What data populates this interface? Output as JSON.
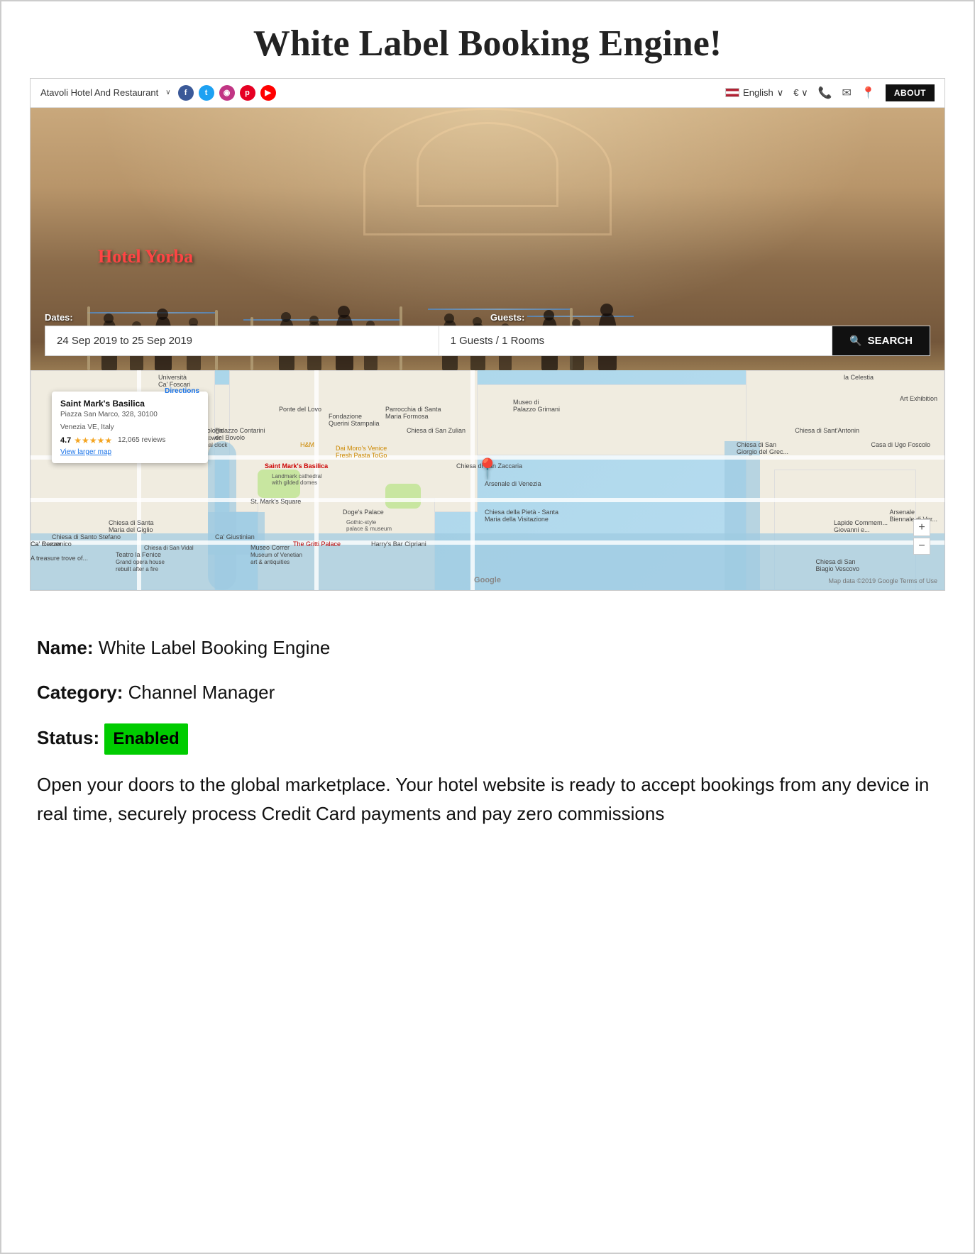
{
  "page": {
    "main_title": "White Label Booking Engine!"
  },
  "navbar": {
    "brand": "Atavoli Hotel And Restaurant",
    "brand_arrow": "∨",
    "social": [
      "f",
      "t",
      "◉",
      "p",
      "▶"
    ],
    "language": "English",
    "currency": "€",
    "about_label": "ABOUT"
  },
  "hero": {
    "hotel_name": "Hotel Yorba",
    "dates_label": "Dates:",
    "guests_label": "Guests:",
    "dates_value": "24 Sep 2019 to 25 Sep 2019",
    "guests_value": "1 Guests / 1 Rooms",
    "search_label": "SEARCH"
  },
  "map": {
    "place_name": "Saint Mark's Basilica",
    "address_line1": "Piazza San Marco, 328, 30100",
    "address_line2": "Venezia VE, Italy",
    "rating": "4.7",
    "stars": "★★★★★",
    "reviews": "12,065 reviews",
    "directions_label": "Directions",
    "larger_map_label": "View larger map",
    "landmark_label": "Saint Mark's Basilica",
    "landmark_sub": "Landmark cathedral with gilded domes",
    "square_label": "St. Mark's Square",
    "doge_label": "Doge's Palace",
    "doge_sub": "Gothic-style palace & museum",
    "google_label": "Google",
    "map_data_label": "Map data ©2019 Google  Terms of Use",
    "zoom_plus": "+",
    "zoom_minus": "−"
  },
  "info": {
    "name_label": "Name:",
    "name_value": "White Label Booking Engine",
    "category_label": "Category:",
    "category_value": "Channel Manager",
    "status_label": "Status:",
    "status_value": "Enabled",
    "description": "Open your doors to the global marketplace. Your hotel website is ready to accept bookings from any device in real time, securely process Credit Card payments and pay zero commissions"
  }
}
